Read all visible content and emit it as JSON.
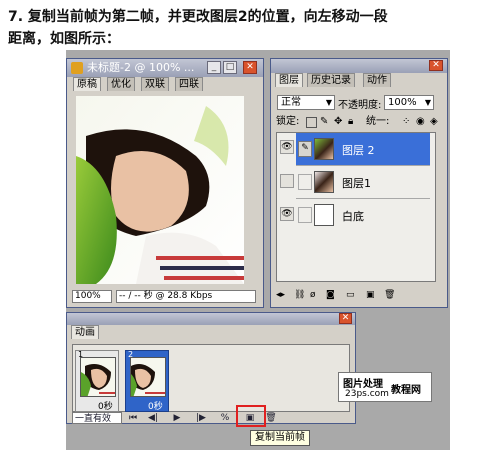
{
  "instruction": {
    "line1": "7. 复制当前帧为第二帧，并更改图层2的位置，向左移动一段",
    "line2": "距离，如图所示："
  },
  "doc_window": {
    "title": "未标题-2 @ 100% ...",
    "tabs": [
      "原稿",
      "优化",
      "双联",
      "四联"
    ],
    "zoom": "100%",
    "status": "-- / -- 秒 @ 28.8 Kbps"
  },
  "layers_panel": {
    "tabs": [
      "图层",
      "历史记录",
      "动作"
    ],
    "blend_mode": "正常",
    "opacity_label": "不透明度:",
    "opacity_value": "100%",
    "lock_label": "锁定:",
    "unify_label": "统一:",
    "layers": [
      {
        "name": "图层 2",
        "visible": true,
        "selected": true
      },
      {
        "name": "图层1",
        "visible": false,
        "selected": false
      },
      {
        "name": "白底",
        "visible": true,
        "selected": false
      }
    ]
  },
  "animation_panel": {
    "tab": "动画",
    "frames": [
      {
        "num": "1",
        "delay": "0秒",
        "selected": false
      },
      {
        "num": "2",
        "delay": "0秒",
        "selected": true
      }
    ],
    "loop": "一直有效",
    "tooltip": "复制当前帧"
  },
  "watermark": {
    "line1": "图片处理",
    "line1b": "教程网",
    "line2": "23ps.com"
  },
  "colors": {
    "selection_blue": "#3a6fd8",
    "highlight_red": "#e02020",
    "panel_gray": "#d4d0c8"
  }
}
